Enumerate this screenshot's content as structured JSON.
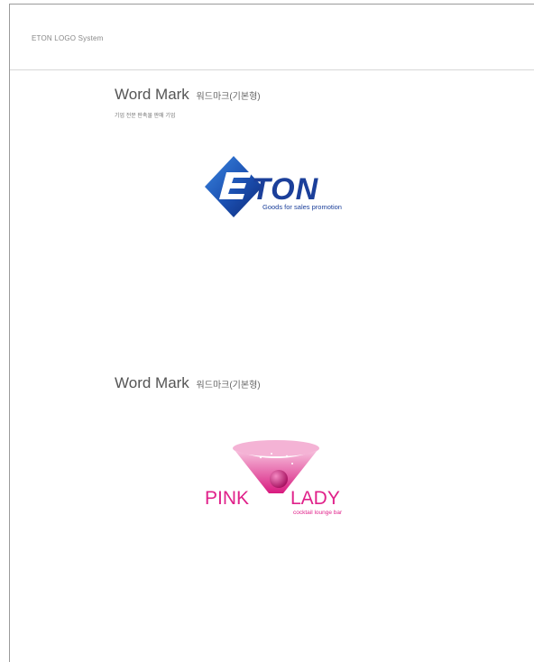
{
  "header": {
    "title": "ETON LOGO System"
  },
  "sections": [
    {
      "title": "Word Mark",
      "title_ko": "워드마크(기본형)",
      "subtitle": "기업 전문 판촉물 판매 기업",
      "logo": {
        "wordmark": "ETON",
        "tagline": "Goods for sales promotion",
        "colors": {
          "primary": "#1b3f9a",
          "accent": "#2d6fd0"
        }
      }
    },
    {
      "title": "Word Mark",
      "title_ko": "워드마크(기본형)",
      "logo": {
        "word1": "PINK",
        "word2": "LADY",
        "tagline": "cocktail lounge bar",
        "colors": {
          "primary": "#e0218a",
          "light": "#f4b3d5"
        }
      }
    }
  ]
}
